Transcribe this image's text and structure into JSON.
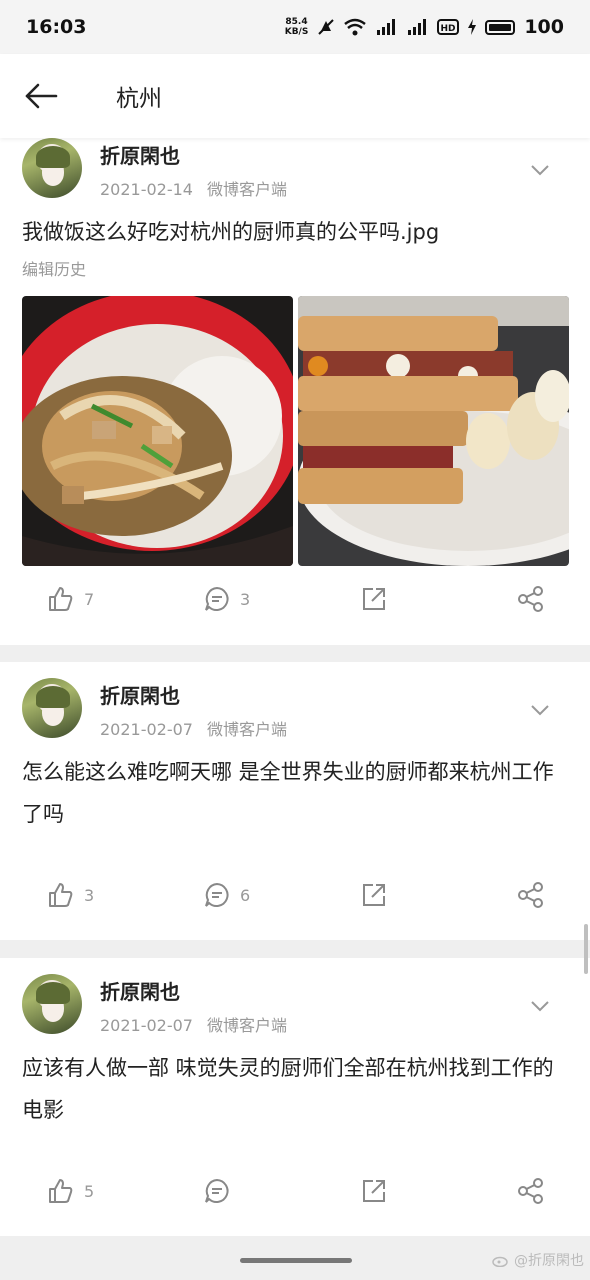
{
  "status_bar": {
    "time": "16:03",
    "net_speed_top": "85.4",
    "net_speed_bottom": "KB/S",
    "battery": "100"
  },
  "nav": {
    "title": "杭州",
    "back_icon": "arrow-left-icon"
  },
  "posts": [
    {
      "user_name": "折原閑也",
      "date": "2021-02-14",
      "source": "微博客户端",
      "text": "我做饭这么好吃对杭州的厨师真的公平吗.jpg",
      "edit_history": "编辑历史",
      "images": [
        "stir-fried-onion-rice-bowl",
        "toast-sandwich-plate"
      ],
      "likes": "7",
      "comments": "3"
    },
    {
      "user_name": "折原閑也",
      "date": "2021-02-07",
      "source": "微博客户端",
      "text": "怎么能这么难吃啊天哪 是全世界失业的厨师都来杭州工作了吗",
      "likes": "3",
      "comments": "6"
    },
    {
      "user_name": "折原閑也",
      "date": "2021-02-07",
      "source": "微博客户端",
      "text": "应该有人做一部 味觉失灵的厨师们全部在杭州找到工作的电影",
      "likes": "5",
      "comments": ""
    }
  ],
  "watermark": "@折原閑也",
  "icons": [
    "thumb-up-icon",
    "comment-icon",
    "repost-icon",
    "share-icon",
    "chevron-down-icon",
    "weibo-logo-icon"
  ]
}
